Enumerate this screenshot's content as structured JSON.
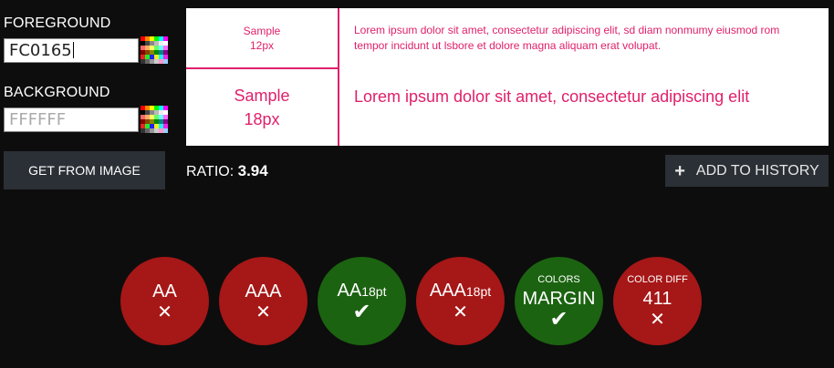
{
  "colors": {
    "foreground_accent": "#e0206a",
    "fail": "#a61717",
    "pass": "#1b6310",
    "button": "#2b3036",
    "background": "#0d0d0d"
  },
  "foreground": {
    "label": "FOREGROUND",
    "value": "FC0165"
  },
  "background": {
    "label": "BACKGROUND",
    "placeholder": "FFFFFF"
  },
  "get_from_image_label": "GET FROM IMAGE",
  "preview": {
    "sample_12_line1": "Sample",
    "sample_12_line2": "12px",
    "sample_18_line1": "Sample",
    "sample_18_line2": "18px",
    "lorem_12": "Lorem ipsum dolor sit amet, consectetur adipiscing elit, sd diam nonmumy eiusmod rom tempor incidunt ut lsbore et dolore magna aliquam erat volupat.",
    "lorem_18": "Lorem ipsum dolor sit amet, consectetur adipiscing elit"
  },
  "ratio": {
    "label": "RATIO:",
    "value": "3.94"
  },
  "history_button": {
    "icon": "plus-icon",
    "label": "ADD TO HISTORY"
  },
  "results": [
    {
      "main": "AA",
      "suffix": "",
      "top": "",
      "status": "fail",
      "icon": "cross-icon",
      "glyph": "✕"
    },
    {
      "main": "AAA",
      "suffix": "",
      "top": "",
      "status": "fail",
      "icon": "cross-icon",
      "glyph": "✕"
    },
    {
      "main": "AA",
      "suffix": "18pt",
      "top": "",
      "status": "pass",
      "icon": "check-icon",
      "glyph": "✔"
    },
    {
      "main": "AAA",
      "suffix": "18pt",
      "top": "",
      "status": "fail",
      "icon": "cross-icon",
      "glyph": "✕"
    },
    {
      "main": "MARGIN",
      "suffix": "",
      "top": "COLORS",
      "status": "pass",
      "icon": "check-icon",
      "glyph": "✔"
    },
    {
      "main": "411",
      "suffix": "",
      "top": "COLOR DIFF",
      "status": "fail",
      "icon": "cross-icon",
      "glyph": "✕"
    }
  ]
}
